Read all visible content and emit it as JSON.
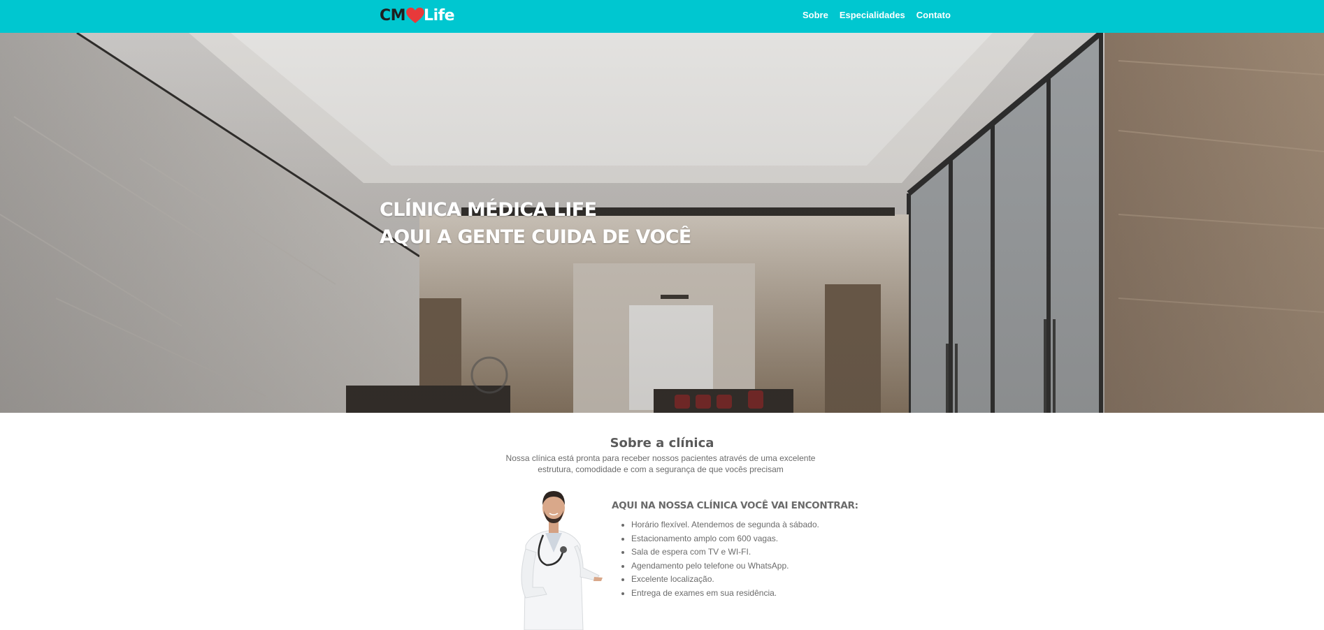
{
  "brand": {
    "logo_left": "CM",
    "logo_right": "Life",
    "heart_color": "#e8393a",
    "primary_color": "#00c7d0"
  },
  "nav": {
    "items": [
      {
        "label": "Sobre"
      },
      {
        "label": "Especialidades"
      },
      {
        "label": "Contato"
      }
    ]
  },
  "hero": {
    "title_line1": "CLÍNICA MÉDICA LIFE",
    "title_line2": "AQUI A GENTE CUIDA DE VOCÊ"
  },
  "about": {
    "title": "Sobre a clínica",
    "description": "Nossa clínica está pronta para receber nossos pacientes através de uma excelente estrutura, comodidade e com a segurança de que vocês precisam",
    "features_title": "AQUI NA NOSSA CLÍNICA VOCÊ VAI ENCONTRAR:",
    "features": [
      "Horário flexível. Atendemos de segunda à sábado.",
      "Estacionamento amplo com 600 vagas.",
      "Sala de espera com TV e WI-FI.",
      "Agendamento pelo telefone ou WhatsApp.",
      "Excelente localização.",
      "Entrega de exames em sua residência."
    ]
  }
}
